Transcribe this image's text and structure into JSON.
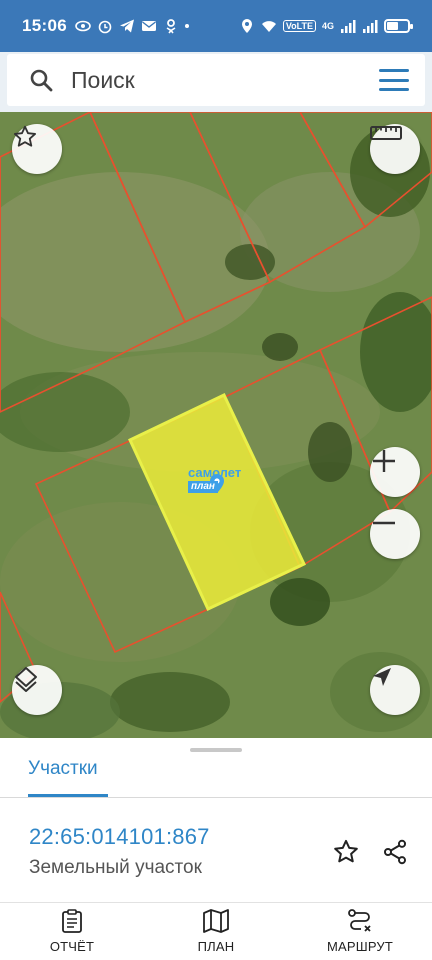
{
  "status_bar": {
    "time": "15:06",
    "network_label": "VoLTE",
    "signal_label": "4G"
  },
  "search": {
    "placeholder": "Поиск"
  },
  "map": {
    "parcel_label_line1": "самолет",
    "parcel_label_line2": "план",
    "highlight_color": "#e8e83a",
    "boundary_color": "#e8502e"
  },
  "sheet": {
    "tab_label": "Участки",
    "cadastral_number": "22:65:014101:867",
    "parcel_type": "Земельный участок"
  },
  "bottom_nav": {
    "items": [
      {
        "label": "ОТЧЁТ",
        "icon": "report-icon"
      },
      {
        "label": "ПЛАН",
        "icon": "map-icon"
      },
      {
        "label": "МАРШРУТ",
        "icon": "route-icon"
      }
    ]
  },
  "colors": {
    "accent": "#2f86c7",
    "status_bar": "#3b78b8"
  }
}
